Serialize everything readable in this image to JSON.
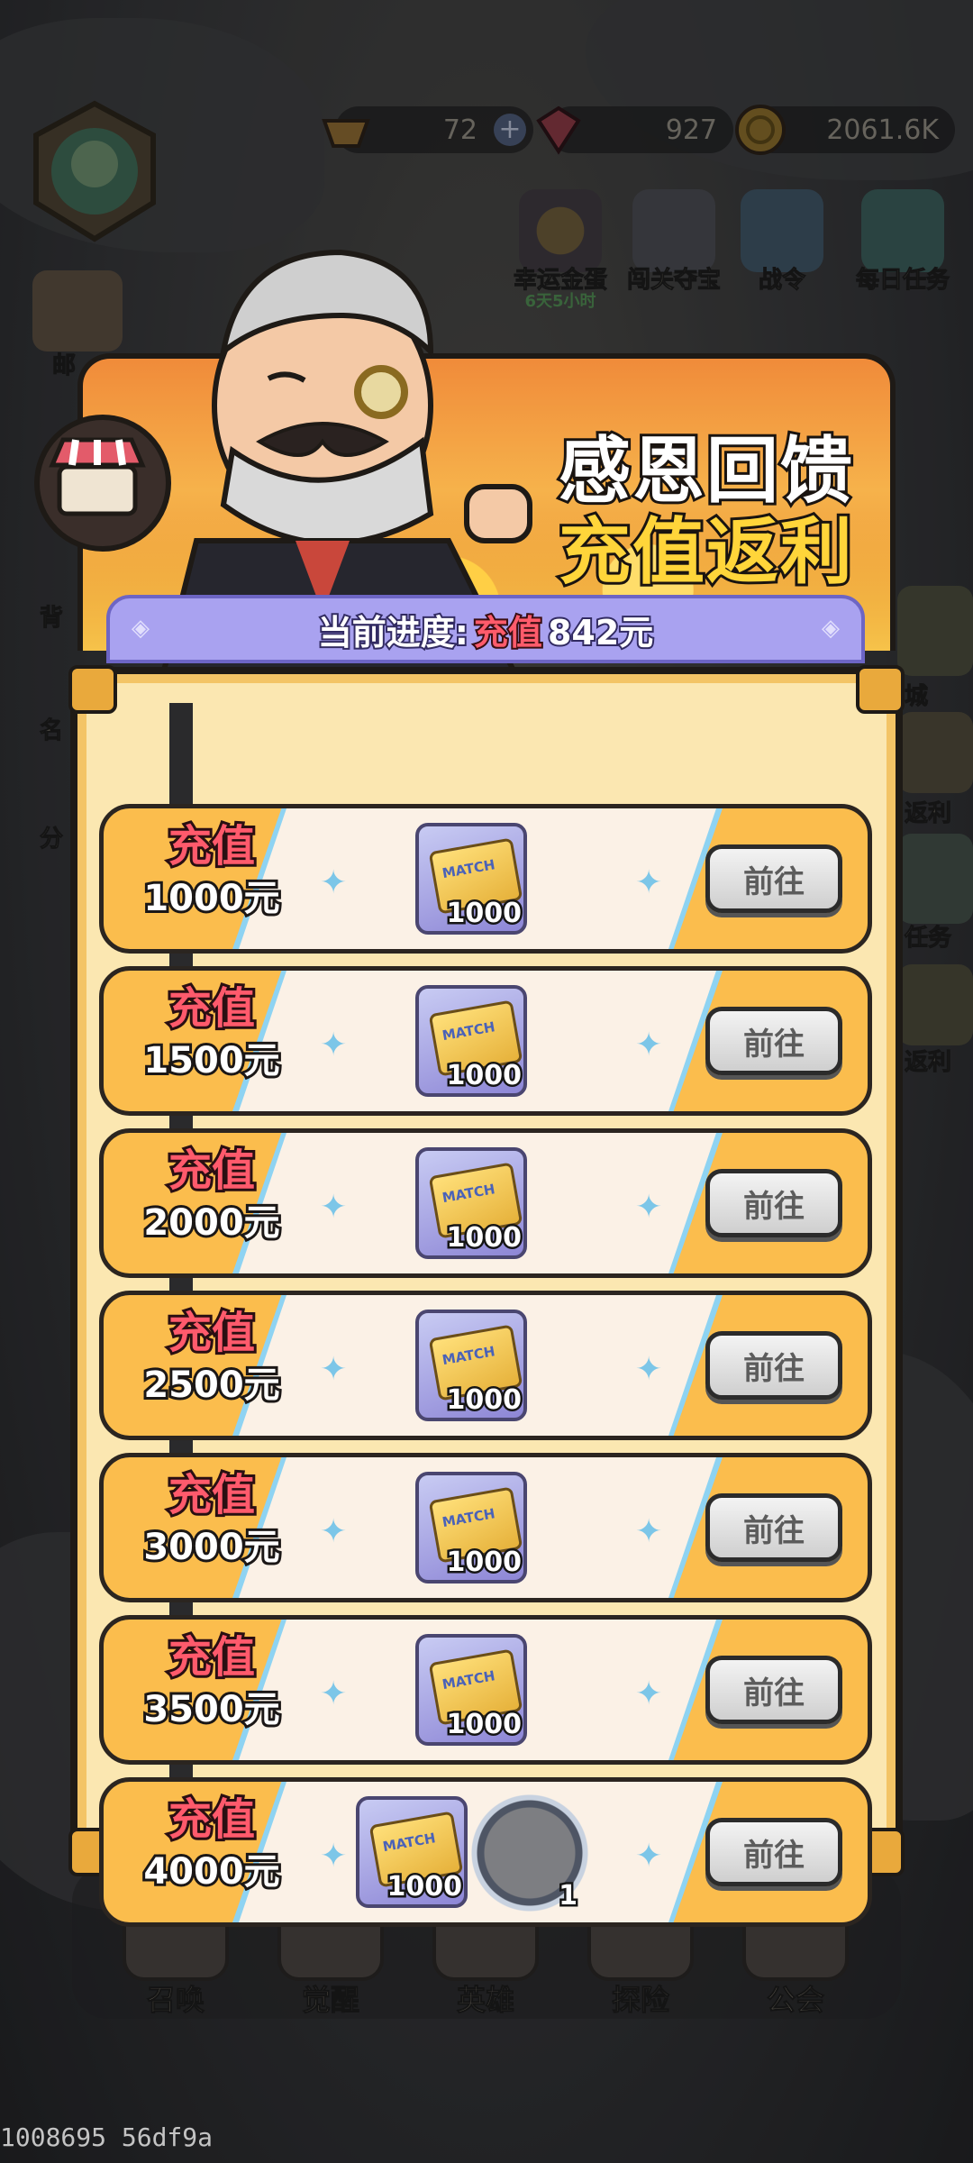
{
  "resources": [
    {
      "name": "gold-ingot",
      "value": "72",
      "has_plus": true
    },
    {
      "name": "ruby",
      "value": "927"
    },
    {
      "name": "coin",
      "value": "2061.6K"
    }
  ],
  "top_icons": [
    {
      "label": "幸运金蛋",
      "sub": "6天5小时"
    },
    {
      "label": "闯关夺宝"
    },
    {
      "label": "战令"
    },
    {
      "label": "每日任务"
    }
  ],
  "side_left": [
    "邮",
    "背",
    "名",
    "分"
  ],
  "side_right": [
    "城",
    "返利",
    "任务",
    "返利"
  ],
  "banner": {
    "title_line1": "感恩回馈",
    "title_line2": "充值返利"
  },
  "progress": {
    "label": "当前进度:",
    "highlight": "充值",
    "value": "842元"
  },
  "tiers": [
    {
      "label": "充值",
      "amount": "1000元",
      "rewards": [
        {
          "item": "MATCH",
          "qty": "1000"
        }
      ],
      "button": "前往"
    },
    {
      "label": "充值",
      "amount": "1500元",
      "rewards": [
        {
          "item": "MATCH",
          "qty": "1000"
        }
      ],
      "button": "前往"
    },
    {
      "label": "充值",
      "amount": "2000元",
      "rewards": [
        {
          "item": "MATCH",
          "qty": "1000"
        }
      ],
      "button": "前往"
    },
    {
      "label": "充值",
      "amount": "2500元",
      "rewards": [
        {
          "item": "MATCH",
          "qty": "1000"
        }
      ],
      "button": "前往"
    },
    {
      "label": "充值",
      "amount": "3000元",
      "rewards": [
        {
          "item": "MATCH",
          "qty": "1000"
        }
      ],
      "button": "前往"
    },
    {
      "label": "充值",
      "amount": "3500元",
      "rewards": [
        {
          "item": "MATCH",
          "qty": "1000"
        }
      ],
      "button": "前往"
    },
    {
      "label": "充值",
      "amount": "4000元",
      "rewards": [
        {
          "item": "MATCH",
          "qty": "1000"
        },
        {
          "item": "hero",
          "qty": "1"
        }
      ],
      "button": "前往"
    }
  ],
  "bottom_nav": [
    "召唤",
    "觉醒",
    "英雄",
    "探险",
    "公会"
  ],
  "footer": {
    "version": "1008695 56df9a"
  },
  "colors": {
    "accent_red": "#ff5a6c",
    "title_yellow": "#ffd53a",
    "tier_orange": "#fbbd4d",
    "progress_purple": "#a9a2f0"
  }
}
